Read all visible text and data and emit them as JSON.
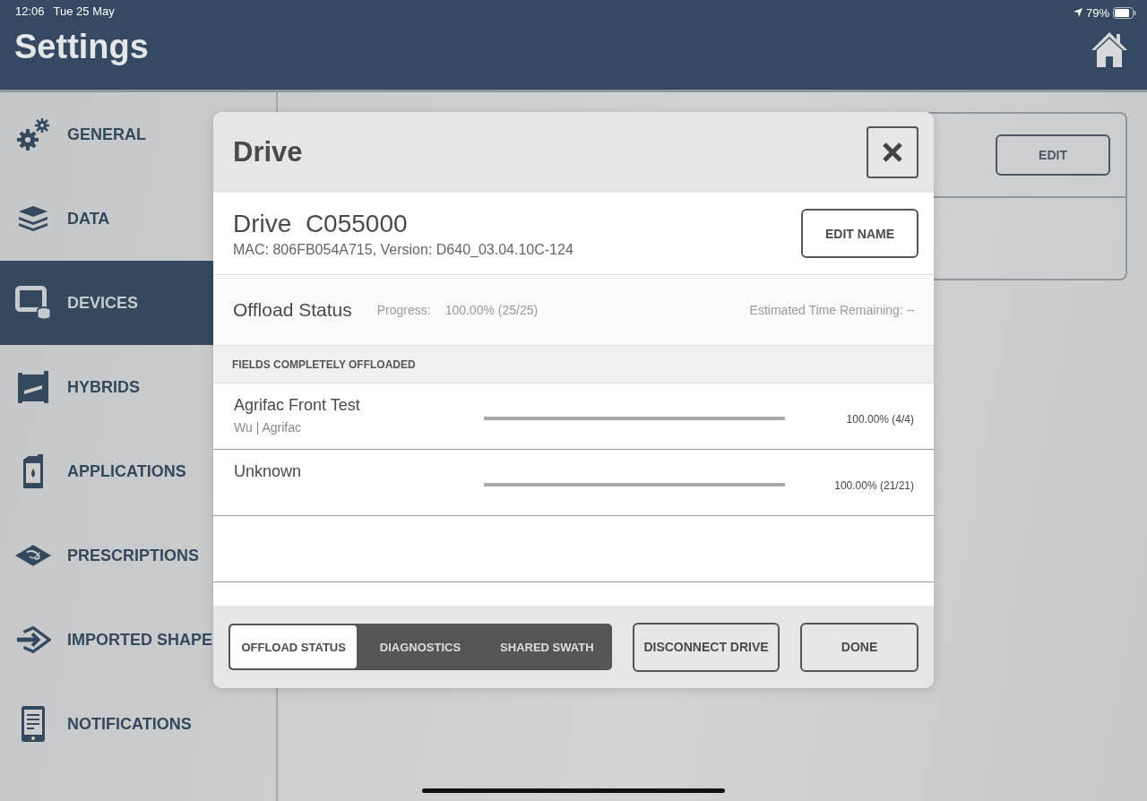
{
  "status_bar": {
    "time": "12:06",
    "date": "Tue 25 May",
    "battery": "79%"
  },
  "header": {
    "title": "Settings"
  },
  "sidebar": {
    "items": [
      {
        "label": "GENERAL",
        "selected": false
      },
      {
        "label": "DATA",
        "selected": false
      },
      {
        "label": "DEVICES",
        "selected": true
      },
      {
        "label": "HYBRIDS",
        "selected": false
      },
      {
        "label": "APPLICATIONS",
        "selected": false
      },
      {
        "label": "PRESCRIPTIONS",
        "selected": false
      },
      {
        "label": "IMPORTED SHAPE",
        "selected": false
      },
      {
        "label": "NOTIFICATIONS",
        "selected": false
      }
    ]
  },
  "background_card": {
    "edit_button": "EDIT"
  },
  "dialog": {
    "title": "Drive",
    "device_name": "Drive  C055000",
    "details": "MAC: 806FB054A715, Version: D640_03.04.10C-124",
    "edit_name_button": "EDIT NAME",
    "offload_status": {
      "title": "Offload Status",
      "progress_label": "Progress:",
      "progress_value": "100.00% (25/25)",
      "time_remaining": "Estimated Time Remaining: --"
    },
    "section_heading": "FIELDS COMPLETELY OFFLOADED",
    "fields": [
      {
        "name": "Agrifac Front Test",
        "subtitle": "Wu | Agrifac",
        "level": 1,
        "reading": "100.00% (4/4)"
      },
      {
        "name": "Unknown",
        "level": 1,
        "reading": "100.00% (21/21)"
      }
    ],
    "tabs": [
      {
        "label": "OFFLOAD STATUS",
        "selected": true
      },
      {
        "label": "DIAGNOSTICS",
        "selected": false
      },
      {
        "label": "SHARED SWATH",
        "selected": false
      }
    ],
    "buttons": [
      "DISCONNECT DRIVE",
      "DONE"
    ]
  }
}
